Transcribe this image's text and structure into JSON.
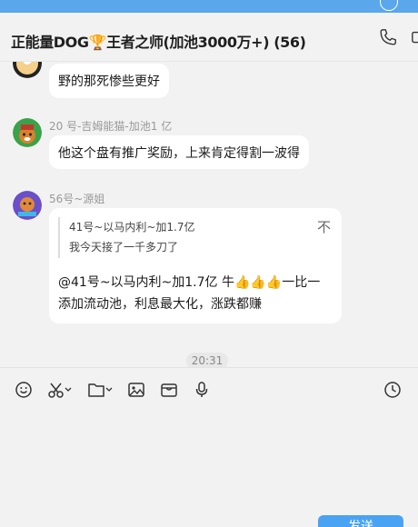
{
  "header": {
    "title": "正能量DOG🏆王者之师(加池3000万+) (56)"
  },
  "messages": [
    {
      "text": "野的那死惨些更好"
    },
    {
      "sender": "20 号-吉姆能猫-加池1 亿",
      "text": "他这个盘有推广奖励，上来肯定得割一波得"
    },
    {
      "sender": "56号~源姐",
      "quote_author": "41号~以马内利~加1.7亿",
      "quote_text": "我今天接了一千多刀了",
      "quote_action": "不",
      "text_line1": "@41号~以马内利~加1.7亿  牛👍👍👍一比一",
      "text_line2": "添加流动池，利息最大化，涨跌都赚"
    }
  ],
  "timestamp": "20:31",
  "toolbar": {
    "icons": [
      "emoji-icon",
      "scissors-icon",
      "folder-icon",
      "image-icon",
      "gift-icon",
      "microphone-icon",
      "history-clock-icon"
    ]
  },
  "send_button": {
    "label": "发送"
  },
  "colors": {
    "accent": "#4aa3f2",
    "top_strip": "#5aa7ec",
    "background": "#f2f2f2",
    "bubble": "#ffffff"
  }
}
